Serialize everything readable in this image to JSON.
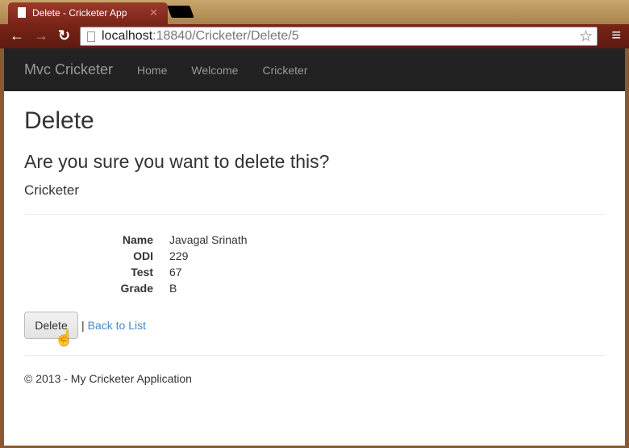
{
  "browser": {
    "tab_title": "Delete - Cricketer App",
    "url_host": "localhost",
    "url_rest": ":18840/Cricketer/Delete/5"
  },
  "navbar": {
    "brand": "Mvc Cricketer",
    "links": [
      "Home",
      "Welcome",
      "Cricketer"
    ]
  },
  "main": {
    "title": "Delete",
    "question": "Are you sure you want to delete this?",
    "entity": "Cricketer",
    "fields": [
      {
        "label": "Name",
        "value": "Javagal Srinath"
      },
      {
        "label": "ODI",
        "value": "229"
      },
      {
        "label": "Test",
        "value": "67"
      },
      {
        "label": "Grade",
        "value": "B"
      }
    ],
    "delete_label": "Delete",
    "separator": "|",
    "back_label": "Back to List"
  },
  "footer": {
    "text": "© 2013 - My Cricketer Application"
  }
}
